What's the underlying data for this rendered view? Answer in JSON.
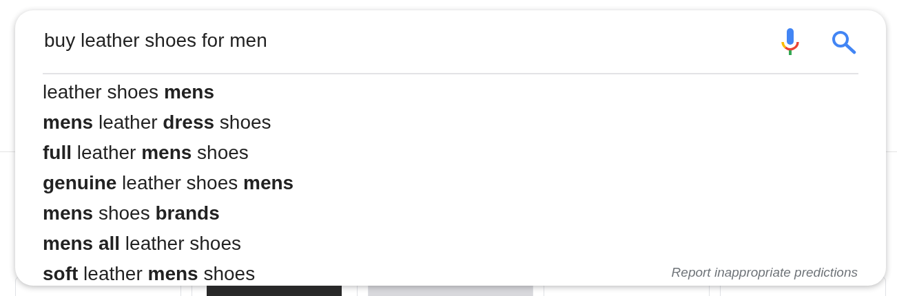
{
  "search": {
    "query": "buy leather shoes for men"
  },
  "suggestions": [
    "leather shoes **mens**",
    "**mens** leather **dress** shoes",
    "**full** leather **mens** shoes",
    "**genuine** leather shoes **mens**",
    "**mens** shoes **brands**",
    "**mens all** leather shoes",
    "**soft** leather **mens** shoes"
  ],
  "report_link": "Report inappropriate predictions"
}
